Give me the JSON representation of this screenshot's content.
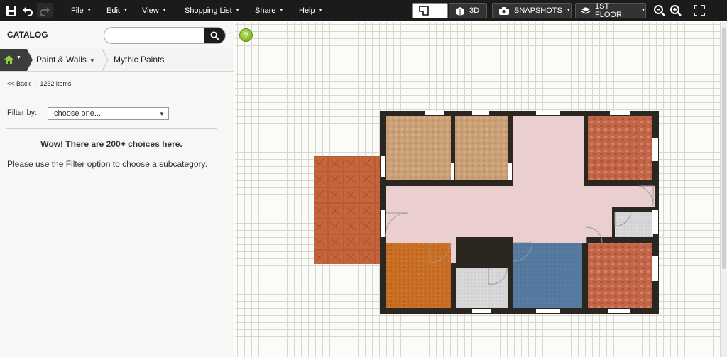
{
  "toolbar": {
    "menus": [
      "File",
      "Edit",
      "View",
      "Shopping List",
      "Share",
      "Help"
    ],
    "view_3d_label": "3D",
    "snapshots_label": "SNAPSHOTS",
    "floor_label": "1ST FLOOR"
  },
  "catalog": {
    "title": "CATALOG",
    "search_placeholder": "",
    "breadcrumb": [
      "Paint & Walls",
      "Mythic Paints"
    ],
    "back_label": "<< Back",
    "item_count": "1232 items",
    "filter_label": "Filter by:",
    "filter_value": "choose one...",
    "notice_title": "Wow! There are 200+ choices here.",
    "notice_text": "Please use the Filter option to choose a subcategory."
  },
  "colors": {
    "topbar": "#1b1b1b",
    "wall": "#2b2620",
    "tile_beige": "#c9a077",
    "brick_orange": "#b95a34",
    "brick_red": "#c2664a",
    "pink_floor": "#ebcfd0",
    "orange_room": "#c86d24",
    "blue_room": "#5679a0",
    "grey_room": "#d6d6d6",
    "help_green": "#8cc63e"
  },
  "icons": [
    "save-icon",
    "undo-icon",
    "redo-icon",
    "plan-view-icon",
    "3d-view-icon",
    "camera-icon",
    "layers-icon",
    "zoom-out-icon",
    "zoom-in-icon",
    "fullscreen-icon",
    "search-icon",
    "home-icon",
    "help-icon"
  ]
}
